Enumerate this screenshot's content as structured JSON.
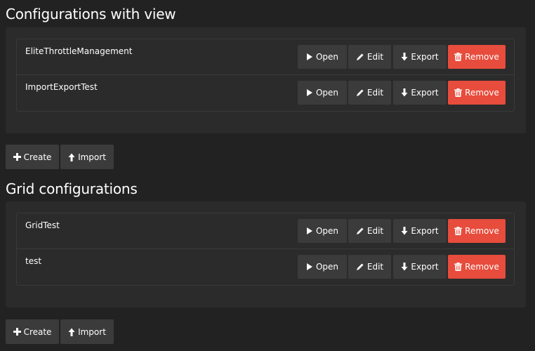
{
  "sections": [
    {
      "title": "Configurations with view",
      "items": [
        {
          "name": "EliteThrottleManagement"
        },
        {
          "name": "ImportExportTest"
        }
      ],
      "create_label": "Create",
      "import_label": "Import"
    },
    {
      "title": "Grid configurations",
      "items": [
        {
          "name": "GridTest"
        },
        {
          "name": "test"
        }
      ],
      "create_label": "Create",
      "import_label": "Import"
    }
  ],
  "row_actions": {
    "open_label": "Open",
    "edit_label": "Edit",
    "export_label": "Export",
    "remove_label": "Remove"
  },
  "colors": {
    "background": "#222222",
    "panel": "#2b2b2b",
    "button": "#3b3b3b",
    "danger": "#e74c3c"
  },
  "icons": {
    "open": "play-icon",
    "edit": "pencil-icon",
    "export": "arrow-down-icon",
    "remove": "trash-icon",
    "create": "plus-icon",
    "import": "arrow-up-icon"
  }
}
